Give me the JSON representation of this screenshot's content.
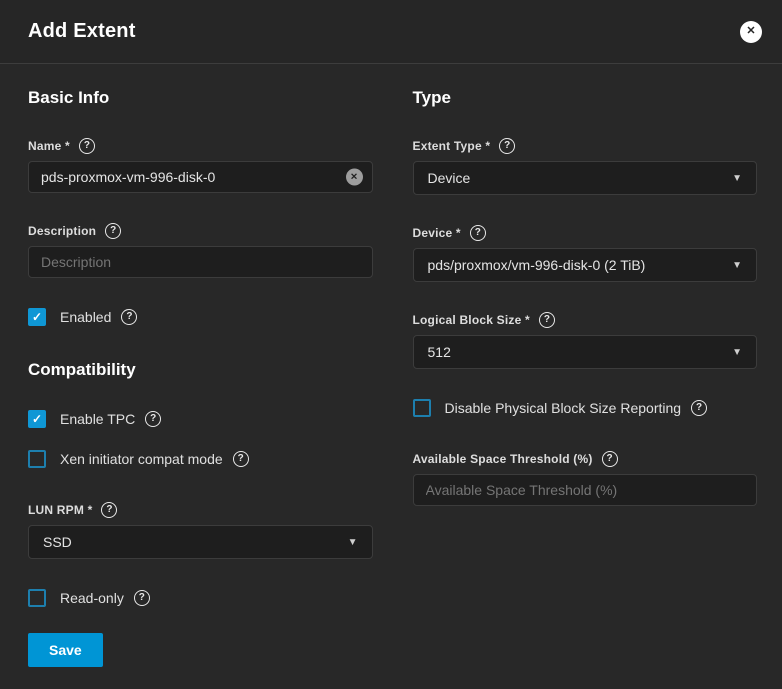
{
  "icons": {
    "help": "?",
    "close": "✕",
    "clear": "✕",
    "caret": "▼",
    "check": "✓"
  },
  "colors": {
    "accent": "#0095d5",
    "background": "#282828",
    "input_background": "#1e1e1e"
  },
  "header": {
    "title": "Add Extent"
  },
  "basic_info": {
    "heading": "Basic Info",
    "name": {
      "label": "Name *",
      "value": "pds-proxmox-vm-996-disk-0"
    },
    "description": {
      "label": "Description",
      "placeholder": "Description"
    },
    "enabled": {
      "label": "Enabled",
      "checked": true
    }
  },
  "compatibility": {
    "heading": "Compatibility",
    "enable_tpc": {
      "label": "Enable TPC",
      "checked": true
    },
    "xen_compat": {
      "label": "Xen initiator compat mode",
      "checked": false
    },
    "lun_rpm": {
      "label": "LUN RPM *",
      "value": "SSD"
    },
    "read_only": {
      "label": "Read-only",
      "checked": false
    }
  },
  "type_section": {
    "heading": "Type",
    "extent_type": {
      "label": "Extent Type *",
      "value": "Device"
    },
    "device": {
      "label": "Device *",
      "value": "pds/proxmox/vm-996-disk-0 (2 TiB)"
    },
    "logical_block_size": {
      "label": "Logical Block Size *",
      "value": "512"
    },
    "disable_physical_block_size": {
      "label": "Disable Physical Block Size Reporting",
      "checked": false
    },
    "available_space_threshold": {
      "label": "Available Space Threshold (%)",
      "placeholder": "Available Space Threshold (%)"
    }
  },
  "actions": {
    "save_label": "Save"
  }
}
